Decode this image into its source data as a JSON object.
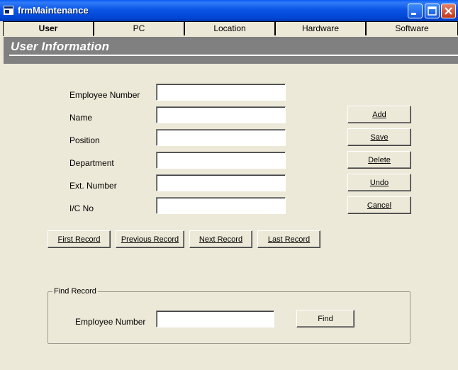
{
  "window": {
    "title": "frmMaintenance"
  },
  "tabs": [
    {
      "label": "User",
      "active": true
    },
    {
      "label": "PC",
      "active": false
    },
    {
      "label": "Location",
      "active": false
    },
    {
      "label": "Hardware",
      "active": false
    },
    {
      "label": "Software",
      "active": false
    }
  ],
  "section_title": "User Information",
  "form": {
    "fields": [
      {
        "label": "Employee Number",
        "value": ""
      },
      {
        "label": "Name",
        "value": ""
      },
      {
        "label": "Position",
        "value": ""
      },
      {
        "label": "Department",
        "value": ""
      },
      {
        "label": "Ext. Number",
        "value": ""
      },
      {
        "label": "I/C No",
        "value": ""
      }
    ]
  },
  "actions": {
    "add": "Add",
    "save": "Save",
    "delete": "Delete",
    "undo": "Undo",
    "cancel": "Cancel"
  },
  "navigation": {
    "first": "First Record",
    "previous": "Previous Record",
    "next": "Next Record",
    "last": "Last Record"
  },
  "find": {
    "group_title": "Find Record",
    "label": "Employee Number",
    "value": "",
    "button": "Find"
  }
}
